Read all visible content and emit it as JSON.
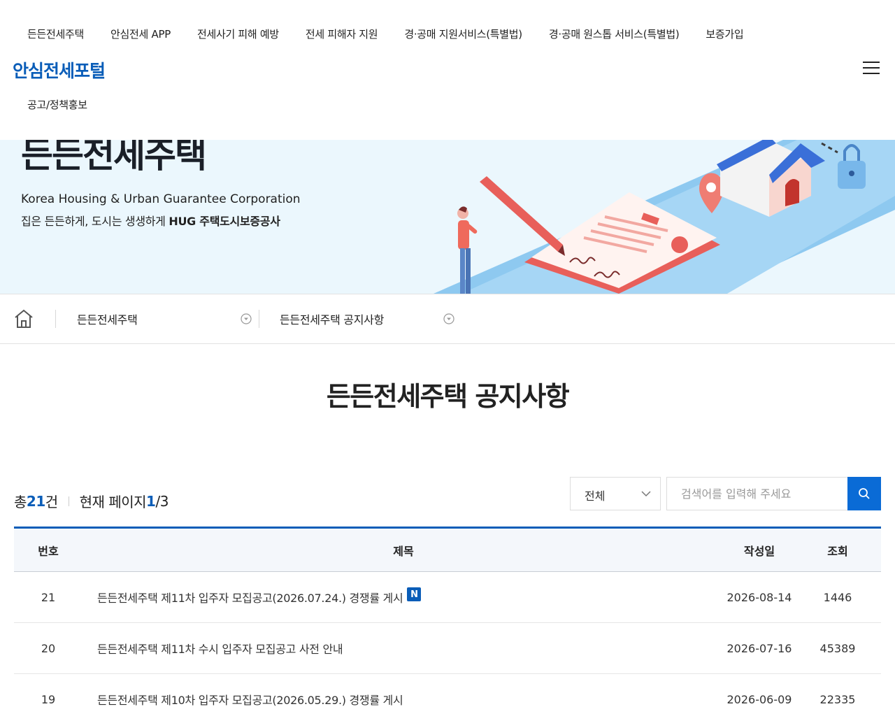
{
  "nav": {
    "menu": [
      "든든전세주택",
      "안심전세 APP",
      "전세사기 피해 예방",
      "전세 피해자 지원",
      "경·공매 지원서비스(특별법)",
      "경·공매 원스톱 서비스(특별법)",
      "보증가입"
    ],
    "logo": "안심전세포털",
    "submenu": "공고/정책홍보",
    "menu_icon": "hamburger-icon"
  },
  "hero": {
    "title": "든든전세주택",
    "subtitle_en": "Korea Housing & Urban Guarantee Corporation",
    "subtitle_ko_prefix": "집은 든든하게, 도시는 생생하게 ",
    "subtitle_ko_strong": "HUG 주택도시보증공사"
  },
  "breadcrumb": {
    "home_icon": "home-icon",
    "level1": "든든전세주택",
    "level2": "든든전세주택 공지사항"
  },
  "page_title": "든든전세주택 공지사항",
  "summary": {
    "total_prefix": "총 ",
    "total": "21",
    "total_suffix": "건",
    "page_prefix": "현재 페이지 ",
    "page_current": "1",
    "page_sep": "/",
    "page_total": "3"
  },
  "search": {
    "select_value": "전체",
    "placeholder": "검색어를 입력해 주세요",
    "button_icon": "search-icon"
  },
  "table": {
    "headers": {
      "no": "번호",
      "title": "제목",
      "date": "작성일",
      "views": "조회"
    },
    "rows": [
      {
        "no": "21",
        "title": "든든전세주택 제11차 입주자 모집공고(2026.07.24.) 경쟁률 게시",
        "badge": "N",
        "date": "2026-08-14",
        "views": "1446"
      },
      {
        "no": "20",
        "title": "든든전세주택 제11차 수시 입주자 모집공고 사전 안내",
        "date": "2026-07-16",
        "views": "45389"
      },
      {
        "no": "19",
        "title": "든든전세주택 제10차 입주자 모집공고(2026.05.29.) 경쟁률 게시",
        "date": "2026-06-09",
        "views": "22335"
      }
    ]
  },
  "colors": {
    "brand_blue": "#0a5db8",
    "search_blue": "#0a6bd6",
    "hero_bg": "#ebf7fd"
  }
}
